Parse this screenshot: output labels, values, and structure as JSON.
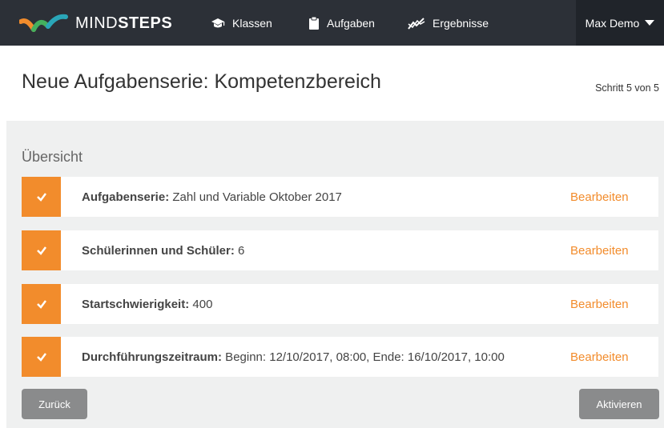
{
  "brand": {
    "name_part1": "MIND",
    "name_part2": "STEPS",
    "colors": {
      "orange": "#f28c2c",
      "green": "#44b05e",
      "teal": "#2aa6b8"
    }
  },
  "nav": {
    "items": [
      {
        "label": "Klassen",
        "icon": "graduation-cap-icon"
      },
      {
        "label": "Aufgaben",
        "icon": "clipboard-icon"
      },
      {
        "label": "Ergebnisse",
        "icon": "chart-line-icon"
      }
    ],
    "user": "Max Demo"
  },
  "page": {
    "title": "Neue Aufgabenserie: Kompetenzbereich",
    "step": "Schritt 5 von 5"
  },
  "overview": {
    "title": "Übersicht",
    "edit_label": "Bearbeiten",
    "rows": [
      {
        "label": "Aufgabenserie:",
        "value": " Zahl und Variable Oktober 2017"
      },
      {
        "label": "Schülerinnen und Schüler:",
        "value": " 6"
      },
      {
        "label": "Startschwierigkeit:",
        "value": " 400"
      },
      {
        "label": "Durchführungszeitraum:",
        "value": " Beginn: 12/10/2017, 08:00, Ende: 16/10/2017, 10:00"
      }
    ]
  },
  "actions": {
    "back": "Zurück",
    "activate": "Aktivieren"
  },
  "colors": {
    "navbar": "#2c3037",
    "accent": "#f28c2c",
    "panel": "#eff0f0",
    "button": "#8a8b8c"
  }
}
